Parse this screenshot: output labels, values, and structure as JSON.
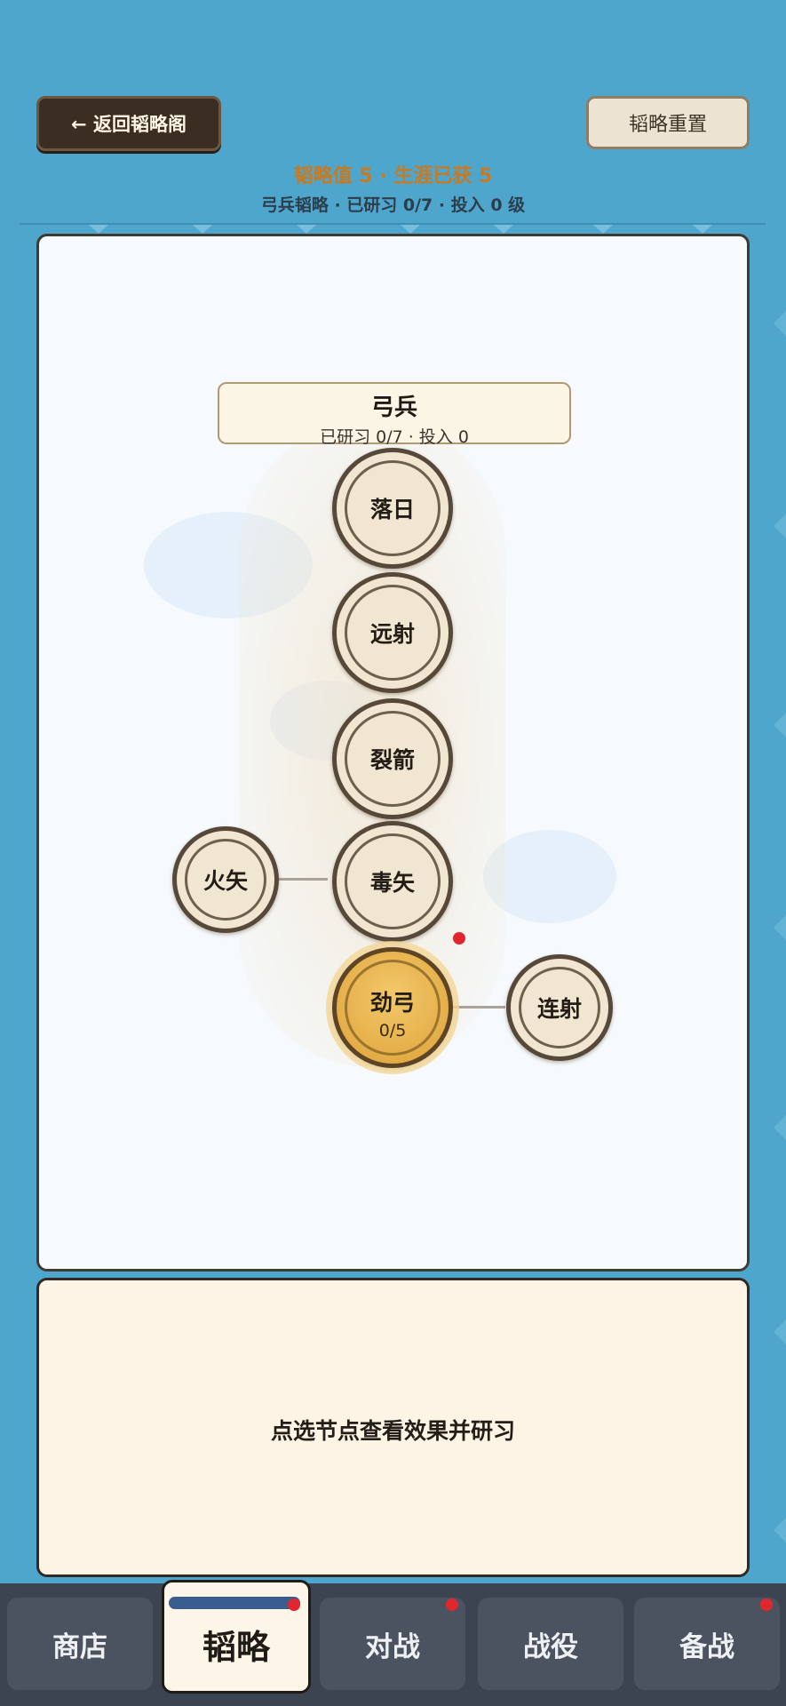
{
  "header": {
    "back_label": "← 返回韬略阁",
    "reset_label": "韬略重置",
    "stats_line": "韬略值 5 · 生涯已获 5",
    "branch_line": "弓兵韬略 · 已研习 0/7 · 投入 0 级"
  },
  "tree": {
    "branch_title": "弓兵",
    "branch_progress": "已研习 0/7 · 投入 0",
    "nodes": {
      "luori": "落日",
      "yuanshe": "远射",
      "liejian": "裂箭",
      "dushi": "毒矢",
      "huoshi": "火矢",
      "jingong": "劲弓",
      "jingong_level": "0/5",
      "lianshe": "连射"
    }
  },
  "info": {
    "prompt": "点选节点查看效果并研习"
  },
  "nav": {
    "shop": "商店",
    "strategy": "韬略",
    "battle": "对战",
    "campaign": "战役",
    "prepare": "备战"
  },
  "colors": {
    "background": "#4fa6cc",
    "accent_gold": "#dda238",
    "badge_red": "#e0272e"
  }
}
